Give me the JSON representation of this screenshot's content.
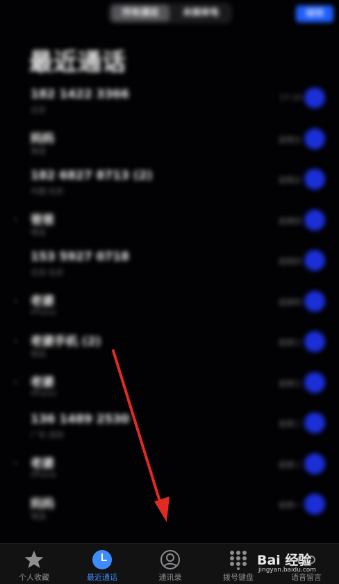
{
  "header": {
    "segments": [
      "所有通话",
      "未接来电"
    ],
    "edit_label": "编辑",
    "title": "最近通话"
  },
  "calls": [
    {
      "name": "182 1422 3366",
      "sub": "北京",
      "time": "17:10",
      "missed": false
    },
    {
      "name": "妈妈",
      "sub": "电话",
      "time": "星期五",
      "missed": false
    },
    {
      "name": "182 6827 8713 (2)",
      "sub": "中国·北京",
      "time": "星期五",
      "missed": false
    },
    {
      "name": "爸爸",
      "sub": "电话",
      "time": "星期四",
      "missed": true
    },
    {
      "name": "153 5927 0718",
      "sub": "北京·北京",
      "time": "星期四",
      "missed": false
    },
    {
      "name": "老婆",
      "sub": "iPhone",
      "time": "星期四",
      "missed": true
    },
    {
      "name": "老婆手机 (2)",
      "sub": "电话",
      "time": "星期三",
      "missed": true
    },
    {
      "name": "老婆",
      "sub": "iPhone",
      "time": "星期三",
      "missed": true
    },
    {
      "name": "136 1489 2530",
      "sub": "广东·深圳",
      "time": "星期二",
      "missed": false
    },
    {
      "name": "老婆",
      "sub": "iPhone",
      "time": "星期二",
      "missed": true
    },
    {
      "name": "妈妈",
      "sub": "电话",
      "time": "星期一",
      "missed": false
    }
  ],
  "tabbar": {
    "items": [
      {
        "label": "个人收藏",
        "icon": "star-icon",
        "active": false
      },
      {
        "label": "最近通话",
        "icon": "clock-icon",
        "active": true
      },
      {
        "label": "通讯录",
        "icon": "contact-icon",
        "active": false
      },
      {
        "label": "拨号键盘",
        "icon": "keypad-icon",
        "active": false
      },
      {
        "label": "语音留言",
        "icon": "voicemail-icon",
        "active": false
      }
    ]
  },
  "watermark": {
    "text": "Bai 经验",
    "url": "jingyan.baidu.com"
  },
  "colors": {
    "background": "#020204",
    "accent": "#3f8cff",
    "info_button": "#1b2fd8",
    "arrow": "#e02a22"
  }
}
